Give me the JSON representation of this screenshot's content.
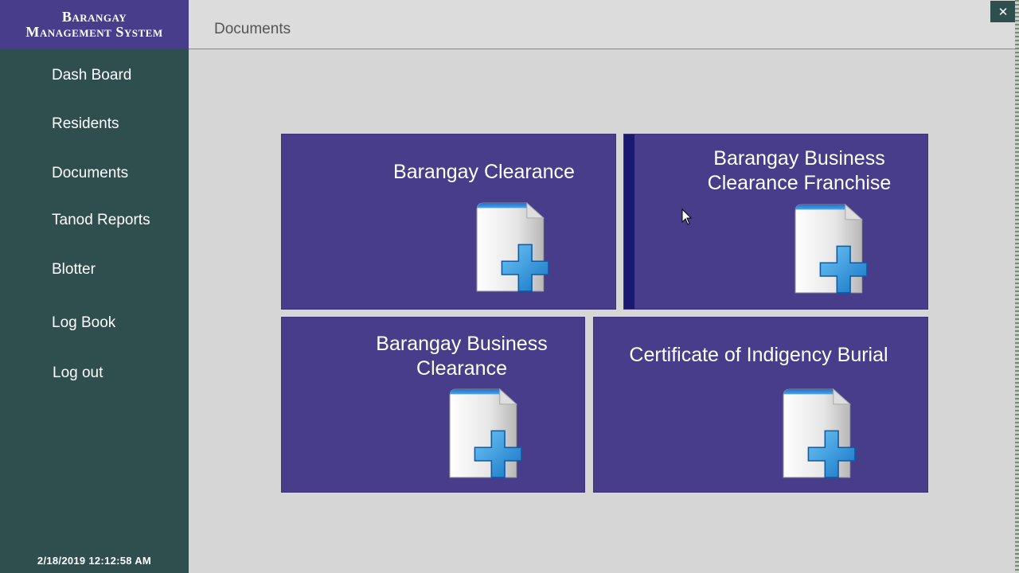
{
  "app": {
    "title_line1": "Barangay",
    "title_line2": "Management System",
    "close_label": "✕"
  },
  "header": {
    "title": "Documents"
  },
  "sidebar": {
    "items": [
      {
        "label": "Dash Board"
      },
      {
        "label": "Residents"
      },
      {
        "label": "Documents"
      },
      {
        "label": "Tanod Reports"
      },
      {
        "label": "Blotter"
      },
      {
        "label": "Log Book"
      },
      {
        "label": "Log out"
      }
    ],
    "datetime": "2/18/2019 12:12:58 AM"
  },
  "tiles": [
    {
      "line1": "Barangay Clearance",
      "line2": "",
      "icon": "document-add-icon"
    },
    {
      "line1": "Barangay Business",
      "line2": "Clearance Franchise",
      "icon": "document-add-icon"
    },
    {
      "line1": "Barangay Business",
      "line2": "Clearance",
      "icon": "document-add-icon"
    },
    {
      "line1": "Certificate of Indigency Burial",
      "line2": "",
      "icon": "document-add-icon"
    }
  ],
  "colors": {
    "brand": "#483d8b",
    "sidebar": "#2f4f4f",
    "tile": "#483d8b",
    "tile_accent": "#191970",
    "background": "#d6d6d6"
  }
}
